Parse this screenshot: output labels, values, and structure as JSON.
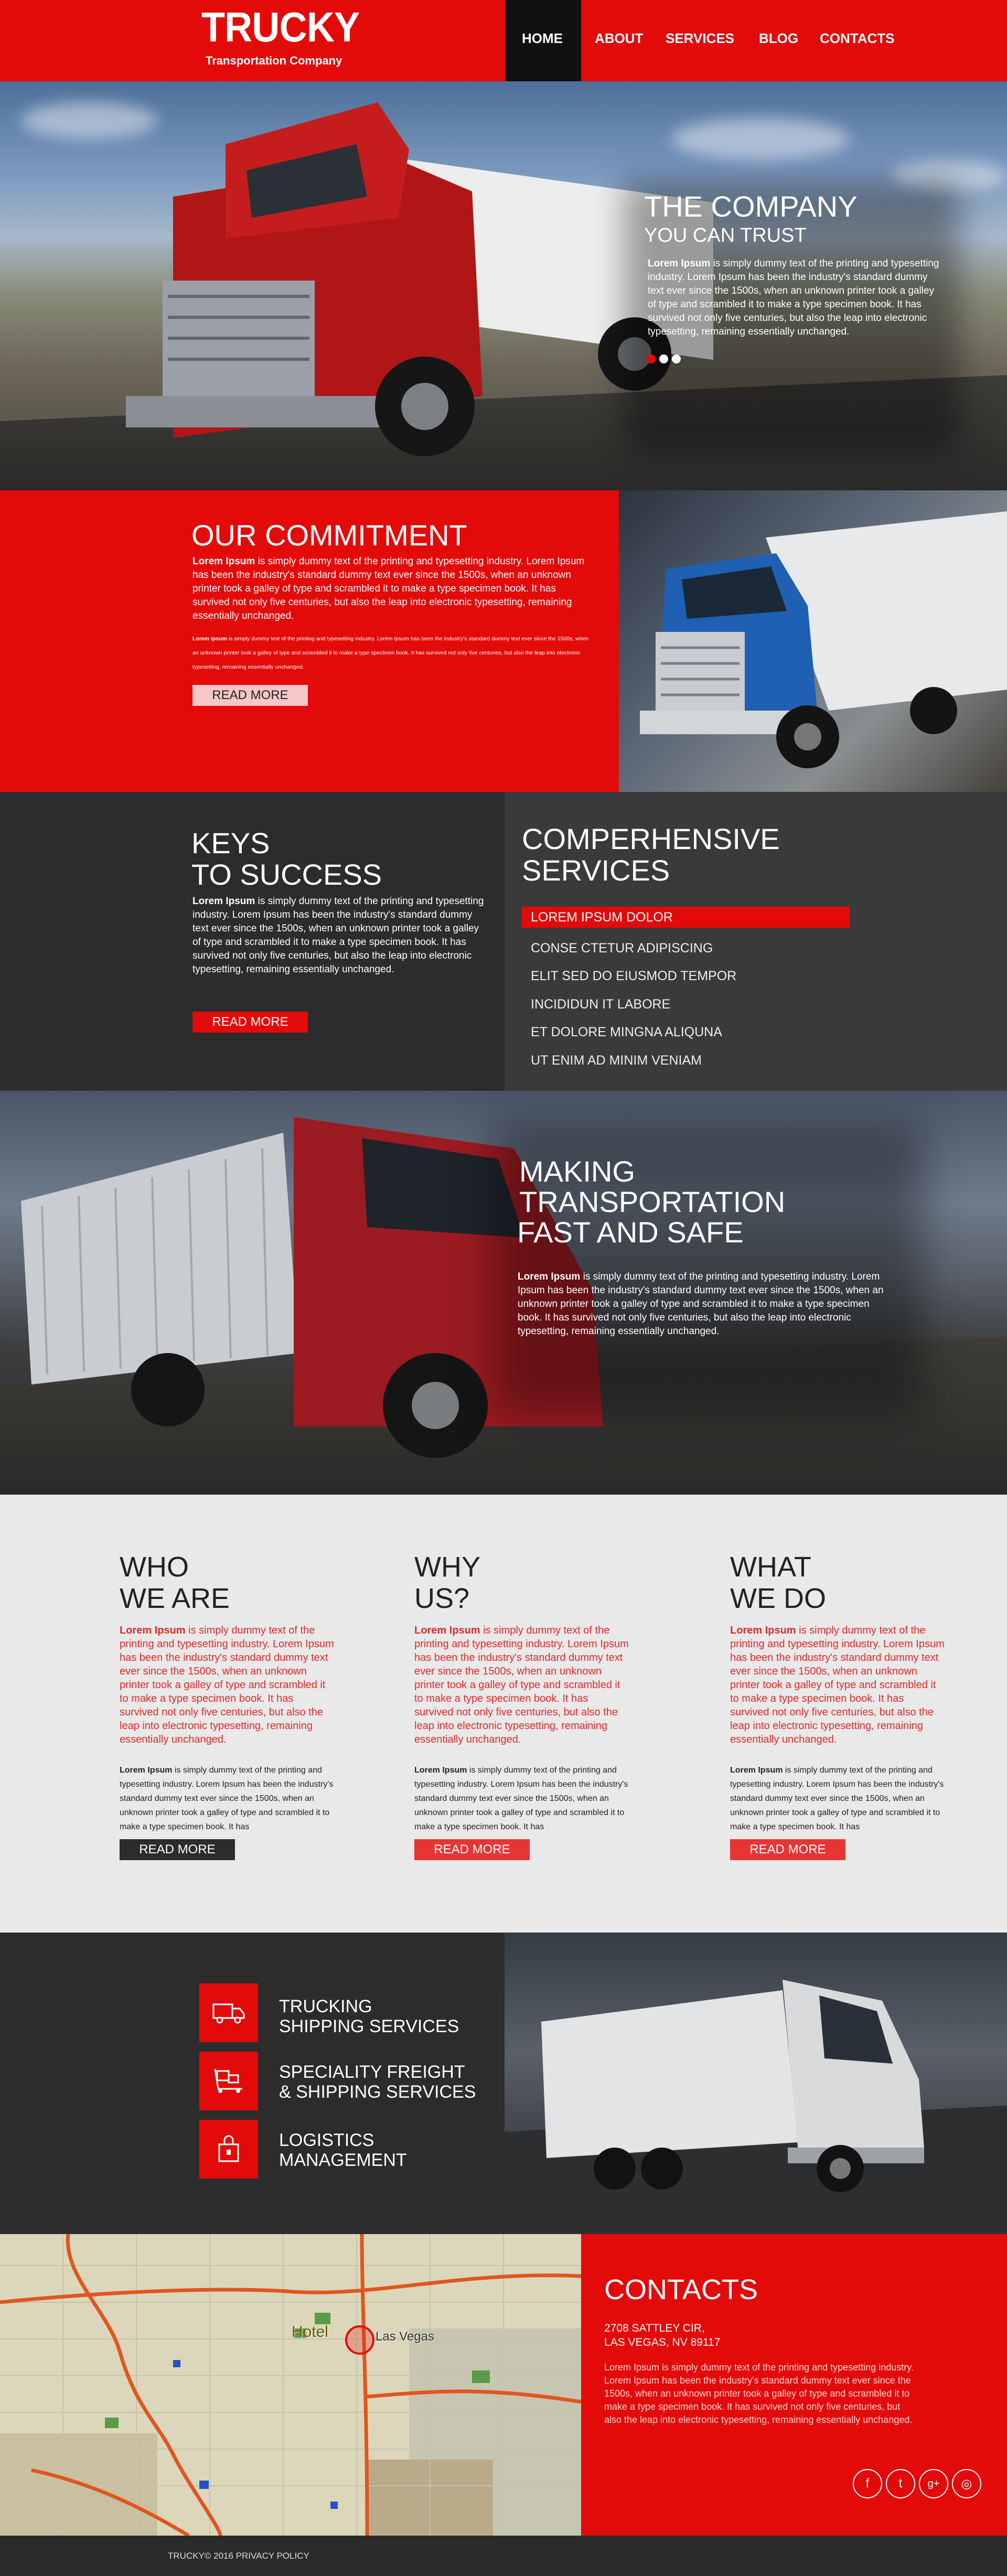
{
  "brand": {
    "title": "TRUCKY",
    "subtitle": "Transportation Company"
  },
  "nav": {
    "items": [
      {
        "label": "HOME",
        "active": true
      },
      {
        "label": "ABOUT"
      },
      {
        "label": "SERVICES"
      },
      {
        "label": "BLOG"
      },
      {
        "label": "CONTACTS"
      }
    ]
  },
  "hero": {
    "title": "THE COMPANY",
    "subtitle": "YOU CAN TRUST",
    "lead": "Lorem Ipsum",
    "text": " is simply dummy text of the printing and typesetting industry. Lorem Ipsum has been the industry's standard dummy text ever since the 1500s, when an unknown printer took a galley of type and scrambled it to make a type specimen book. It has survived not only five centuries, but also the leap into electronic typesetting, remaining essentially unchanged.",
    "active_slide": 1,
    "slide_count": 3
  },
  "commitment": {
    "title": "OUR COMMITMENT",
    "lead": "Lorem Ipsum",
    "text": " is simply dummy text of the printing and typesetting industry. Lorem Ipsum has been the industry's standard dummy text ever since the 1500s, when an unknown printer took a galley of type and scrambled it to make a type specimen book. It has survived not only five centuries, but also the leap into electronic typesetting, remaining essentially unchanged.",
    "small_lead": "Lorem Ipsum",
    "small_text": " is simply dummy text of the printing and typesetting industry. Lorem Ipsum has been the industry's standard dummy text ever since the 1500s, when an unknown printer took a galley of type and scrambled it to make a type specimen book. It has survived not only five centuries, but also the leap into electronic typesetting, remaining essentially unchanged.",
    "button": "READ MORE"
  },
  "keys": {
    "title_line1": "KEYS",
    "title_line2": "TO SUCCESS",
    "lead": "Lorem Ipsum",
    "text": " is simply dummy text of the printing and typesetting industry. Lorem Ipsum has been the industry's standard dummy text ever since the 1500s, when an unknown printer took a galley of type and scrambled it to make a type specimen book. It has survived not only five centuries, but also the leap into electronic typesetting, remaining essentially unchanged.",
    "button": "READ MORE"
  },
  "services": {
    "title_line1": "COMPERHENSIVE",
    "title_line2": "SERVICES",
    "items": [
      "LOREM IPSUM DOLOR",
      "CONSE CTETUR ADIPISCING",
      "ELIT SED DO EIUSMOD TEMPOR",
      "INCIDIDUN IT LABORE",
      "ET DOLORE MINGNA ALIQUNA",
      "UT ENIM AD MINIM VENIAM"
    ],
    "active_index": 0
  },
  "making": {
    "line1": "MAKING",
    "line2": "TRANSPORTATION",
    "line3": "FAST AND SAFE",
    "lead": "Lorem Ipsum",
    "text": " is simply dummy text of the printing and typesetting industry. Lorem Ipsum has been the industry's standard dummy text ever since the 1500s, when an unknown printer took a galley of type and scrambled it to make a type specimen book. It has survived not only five centuries, but also the leap into electronic typesetting, remaining essentially unchanged."
  },
  "columns": [
    {
      "title_line1": "WHO",
      "title_line2": "WE ARE",
      "red_lead": "Lorem Ipsum",
      "red_text": " is simply dummy text of the printing and typesetting industry. Lorem Ipsum has been the industry's standard dummy text ever since the 1500s, when an unknown printer took a galley of type and scrambled it to make a type specimen book. It has survived not only five centuries, but also the leap into electronic typesetting, remaining essentially unchanged.",
      "dark_lead": "Lorem Ipsum",
      "dark_text": " is simply dummy text of the printing and typesetting industry. Lorem Ipsum has been the industry's standard dummy text ever since the 1500s, when an unknown printer took a galley of type and scrambled it to make a type specimen book. It has",
      "button": "READ MORE"
    },
    {
      "title_line1": "WHY",
      "title_line2": "US?",
      "red_lead": "Lorem Ipsum",
      "red_text": " is simply dummy text of the printing and typesetting industry. Lorem Ipsum has been the industry's standard dummy text ever since the 1500s, when an unknown printer took a galley of type and scrambled it to make a type specimen book. It has survived not only five centuries, but also the leap into electronic typesetting, remaining essentially unchanged.",
      "dark_lead": "Lorem Ipsum",
      "dark_text": " is simply dummy text of the printing and typesetting industry. Lorem Ipsum has been the industry's standard dummy text ever since the 1500s, when an unknown printer took a galley of type and scrambled it to make a type specimen book. It has",
      "button": "READ MORE"
    },
    {
      "title_line1": "WHAT",
      "title_line2": "WE DO",
      "red_lead": "Lorem Ipsum",
      "red_text": " is simply dummy text of the printing and typesetting industry. Lorem Ipsum has been the industry's standard dummy text ever since the 1500s, when an unknown printer took a galley of type and scrambled it to make a type specimen book. It has survived not only five centuries, but also the leap into electronic typesetting, remaining essentially unchanged.",
      "dark_lead": "Lorem Ipsum",
      "dark_text": " is simply dummy text of the printing and typesetting industry. Lorem Ipsum has been the industry's standard dummy text ever since the 1500s, when an unknown printer took a galley of type and scrambled it to make a type specimen book. It has",
      "button": "READ MORE"
    }
  ],
  "features": [
    {
      "line1": "TRUCKING",
      "line2": "SHIPPING SERVICES",
      "icon": "truck-icon"
    },
    {
      "line1": "SPECIALITY FREIGHT",
      "line2": "& SHIPPING SERVICES",
      "icon": "dolly-icon"
    },
    {
      "line1": "LOGISTICS",
      "line2": "MANAGEMENT",
      "icon": "package-icon"
    }
  ],
  "map": {
    "city_label": "Las Vegas",
    "pin_label": "Hotel"
  },
  "contacts": {
    "title": "CONTACTS",
    "address_line1": "2708 SATTLEY CIR,",
    "address_line2": "LAS VEGAS, NV 89117",
    "text": "Lorem Ipsum is simply dummy text of the printing and typesetting industry. Lorem Ipsum has been the industry's standard dummy text ever since the 1500s, when an unknown printer took a galley of type and scrambled it to make a type specimen book. It has survived not only five centuries, but also the leap into electronic typesetting, remaining essentially unchanged.",
    "social": [
      {
        "name": "facebook-icon",
        "glyph": "f"
      },
      {
        "name": "twitter-icon",
        "glyph": "t"
      },
      {
        "name": "google-plus-icon",
        "glyph": "g+"
      },
      {
        "name": "instagram-icon",
        "glyph": "◎"
      }
    ]
  },
  "footer": {
    "text": "TRUCKY© 2016 PRIVACY POLICY"
  },
  "colors": {
    "accent": "#e30a0a",
    "dark": "#2c2c2c",
    "light": "#e9e9e9"
  }
}
